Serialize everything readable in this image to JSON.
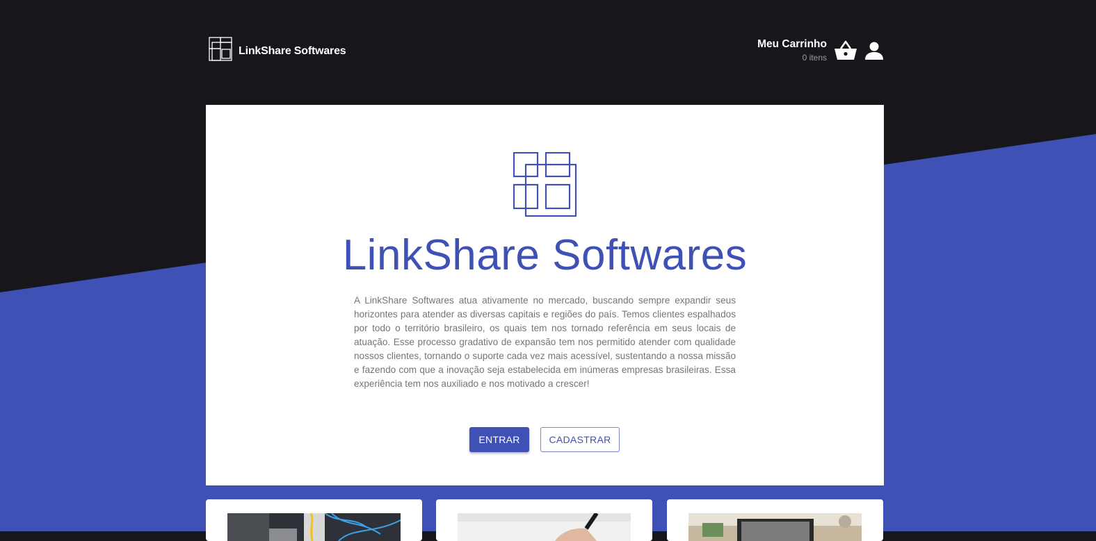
{
  "colors": {
    "accent": "#3f51b5",
    "dark_bg": "#17161b",
    "card_bg": "#ffffff",
    "muted_text": "#757575"
  },
  "header": {
    "brand_name": "LinkShare Softwares",
    "brand_icon": "grid-logo-icon",
    "cart_title": "Meu Carrinho",
    "cart_count": "0 itens",
    "cart_icon": "shopping-basket-icon",
    "user_icon": "user-account-icon"
  },
  "hero": {
    "logo_icon": "grid-logo-icon",
    "title": "LinkShare Softwares",
    "description": "A LinkShare Softwares atua ativamente no mercado, buscando sempre expandir seus horizontes para atender as diversas capitais e regiões do país. Temos clientes espalhados por todo o território brasileiro, os quais tem nos tornado referência em seus locais de atuação. Esse processo gradativo de expansão tem nos permitido atender com qualidade nossos clientes, tornando o suporte cada vez mais acessível, sustentando a nossa missão e fazendo com que a inovação seja estabelecida em inúmeras empresas brasileiras. Essa experiência tem nos auxiliado e nos motivado a crescer!",
    "login_button": "ENTRAR",
    "register_button": "CADASTRAR"
  },
  "products": [
    {
      "image": "network-cables-photo"
    },
    {
      "image": "hand-writing-photo"
    },
    {
      "image": "desk-laptop-photo"
    }
  ]
}
